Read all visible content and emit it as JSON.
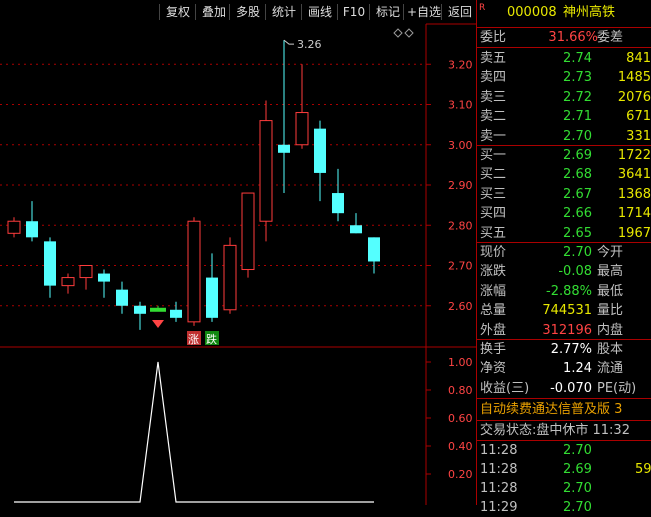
{
  "toolbar": [
    "复权",
    "叠加",
    "多股",
    "统计",
    "画线",
    "F10",
    "标记",
    "+自选",
    "返回"
  ],
  "stock": {
    "badge": "R",
    "code": "000008",
    "name": "神州高铁"
  },
  "commission": {
    "label": "委比",
    "value": "31.66%",
    "label2": "委差"
  },
  "sell": [
    {
      "label": "卖五",
      "price": "2.74",
      "vol": "841"
    },
    {
      "label": "卖四",
      "price": "2.73",
      "vol": "1485"
    },
    {
      "label": "卖三",
      "price": "2.72",
      "vol": "2076"
    },
    {
      "label": "卖二",
      "price": "2.71",
      "vol": "671"
    },
    {
      "label": "卖一",
      "price": "2.70",
      "vol": "331"
    }
  ],
  "buy": [
    {
      "label": "买一",
      "price": "2.69",
      "vol": "1722"
    },
    {
      "label": "买二",
      "price": "2.68",
      "vol": "3641"
    },
    {
      "label": "买三",
      "price": "2.67",
      "vol": "1368"
    },
    {
      "label": "买四",
      "price": "2.66",
      "vol": "1714"
    },
    {
      "label": "买五",
      "price": "2.65",
      "vol": "1967"
    }
  ],
  "quote": [
    {
      "label": "现价",
      "value": "2.70",
      "label2": "今开"
    },
    {
      "label": "涨跌",
      "value": "-0.08",
      "label2": "最高"
    },
    {
      "label": "涨幅",
      "value": "-2.88%",
      "label2": "最低"
    },
    {
      "label": "总量",
      "value": "744531",
      "label2": "量比"
    },
    {
      "label": "外盘",
      "value": "312196",
      "label2": "内盘"
    }
  ],
  "finance": [
    {
      "label": "换手",
      "value": "2.77%",
      "label2": "股本"
    },
    {
      "label": "净资",
      "value": "1.24",
      "label2": "流通"
    },
    {
      "label": "收益(三)",
      "value": "-0.070",
      "label2": "PE(动)"
    }
  ],
  "notice": "自动续费通达信普及版  3",
  "status": "交易状态:盘中休市 11:32",
  "ticks": [
    {
      "time": "11:28",
      "price": "2.70",
      "vol": ""
    },
    {
      "time": "11:28",
      "price": "2.69",
      "vol": "59"
    },
    {
      "time": "11:28",
      "price": "2.70",
      "vol": ""
    },
    {
      "time": "11:29",
      "price": "2.70",
      "vol": ""
    }
  ],
  "chart_labels": {
    "high": "3.26",
    "rise": "涨",
    "fall": "跌"
  },
  "chart_data": [
    {
      "type": "candlestick",
      "ylim": [
        2.5,
        3.3
      ],
      "y_ticks": [
        "3.20",
        "3.10",
        "3.00",
        "2.90",
        "2.80",
        "2.70",
        "2.60"
      ],
      "candles": [
        {
          "o": 2.78,
          "h": 2.82,
          "l": 2.77,
          "c": 2.81,
          "dir": "up"
        },
        {
          "o": 2.81,
          "h": 2.86,
          "l": 2.76,
          "c": 2.77,
          "dir": "down"
        },
        {
          "o": 2.76,
          "h": 2.77,
          "l": 2.62,
          "c": 2.65,
          "dir": "down"
        },
        {
          "o": 2.65,
          "h": 2.68,
          "l": 2.63,
          "c": 2.67,
          "dir": "up"
        },
        {
          "o": 2.67,
          "h": 2.7,
          "l": 2.64,
          "c": 2.7,
          "dir": "up"
        },
        {
          "o": 2.68,
          "h": 2.69,
          "l": 2.62,
          "c": 2.66,
          "dir": "down"
        },
        {
          "o": 2.64,
          "h": 2.66,
          "l": 2.58,
          "c": 2.6,
          "dir": "down"
        },
        {
          "o": 2.6,
          "h": 2.61,
          "l": 2.54,
          "c": 2.58,
          "dir": "down"
        },
        {
          "o": 2.59,
          "h": 2.6,
          "l": 2.59,
          "c": 2.59,
          "dir": "flat"
        },
        {
          "o": 2.59,
          "h": 2.61,
          "l": 2.56,
          "c": 2.57,
          "dir": "down"
        },
        {
          "o": 2.56,
          "h": 2.82,
          "l": 2.55,
          "c": 2.81,
          "dir": "up"
        },
        {
          "o": 2.67,
          "h": 2.73,
          "l": 2.56,
          "c": 2.57,
          "dir": "down"
        },
        {
          "o": 2.59,
          "h": 2.77,
          "l": 2.58,
          "c": 2.75,
          "dir": "up"
        },
        {
          "o": 2.69,
          "h": 2.88,
          "l": 2.67,
          "c": 2.88,
          "dir": "up"
        },
        {
          "o": 2.81,
          "h": 3.11,
          "l": 2.76,
          "c": 3.06,
          "dir": "up"
        },
        {
          "o": 2.98,
          "h": 3.26,
          "l": 2.88,
          "c": 3.0,
          "dir": "down"
        },
        {
          "o": 3.0,
          "h": 3.2,
          "l": 2.99,
          "c": 3.08,
          "dir": "up"
        },
        {
          "o": 3.04,
          "h": 3.06,
          "l": 2.86,
          "c": 2.93,
          "dir": "down"
        },
        {
          "o": 2.88,
          "h": 2.94,
          "l": 2.81,
          "c": 2.83,
          "dir": "down"
        },
        {
          "o": 2.8,
          "h": 2.83,
          "l": 2.78,
          "c": 2.78,
          "dir": "down"
        },
        {
          "o": 2.77,
          "h": 2.77,
          "l": 2.68,
          "c": 2.71,
          "dir": "down"
        }
      ]
    },
    {
      "type": "line",
      "ylim": [
        0,
        1.1
      ],
      "y_ticks": [
        "1.00",
        "0.80",
        "0.60",
        "0.40",
        "0.20"
      ],
      "values": [
        0,
        0,
        0,
        0,
        0,
        0,
        0,
        0,
        1,
        0,
        0,
        0,
        0,
        0,
        0,
        0,
        0,
        0,
        0,
        0,
        0
      ]
    }
  ]
}
